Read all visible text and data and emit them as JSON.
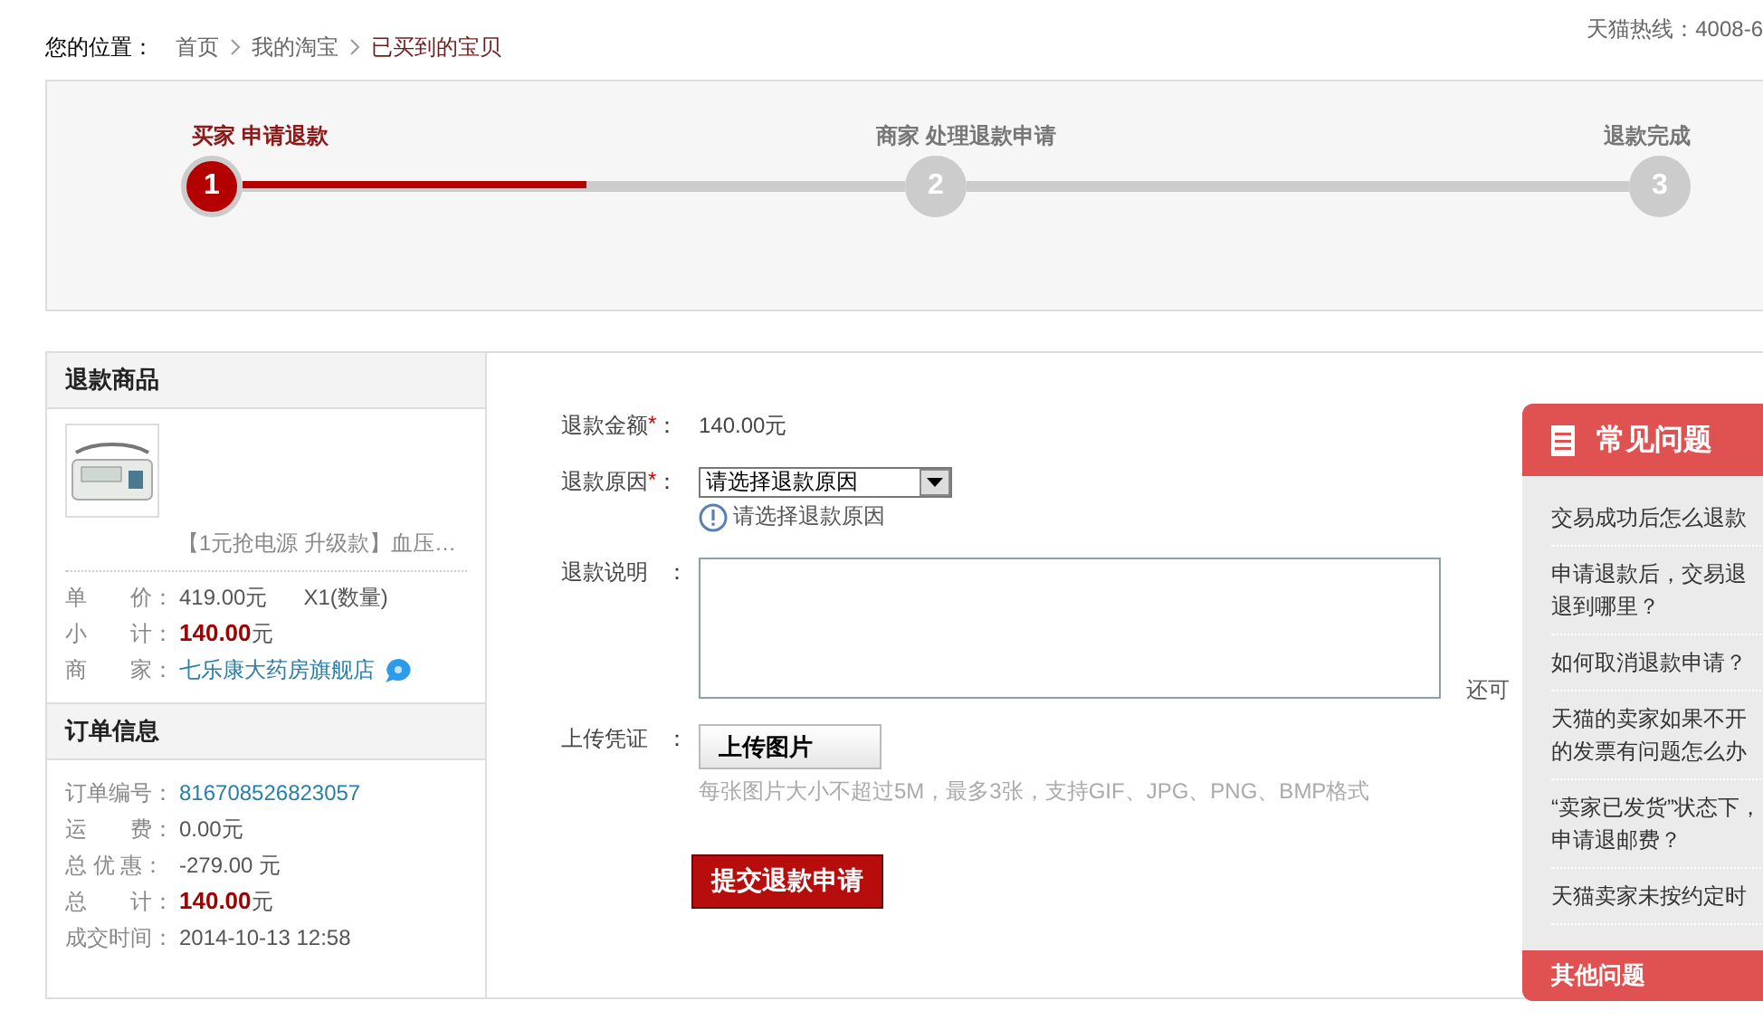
{
  "breadcrumb": {
    "label": "您的位置：",
    "items": [
      {
        "text": "首页",
        "current": false
      },
      {
        "text": "我的淘宝",
        "current": false
      },
      {
        "text": "已买到的宝贝",
        "current": true
      }
    ]
  },
  "hotline": "天猫热线：4008-6",
  "steps": {
    "segments": [
      {
        "level": 0.52
      },
      {
        "level": 0
      }
    ],
    "items": [
      {
        "number": "1",
        "title": "买家 申请退款",
        "selected": true
      },
      {
        "number": "2",
        "title": "商家 处理退款申请",
        "selected": false
      },
      {
        "number": "3",
        "title": "退款完成",
        "selected": false
      }
    ]
  },
  "product_panel": {
    "title": "退款商品",
    "name": "【1元抢电源 升级款】血压…",
    "rows": [
      {
        "label": "单　　价：",
        "value": "419.00元",
        "extra": "X1(数量)",
        "kind": "plain"
      },
      {
        "label": "小　　计：",
        "value": "140.00",
        "unit": "元",
        "kind": "price"
      },
      {
        "label": "商　　家：",
        "value": "七乐康大药房旗舰店",
        "kind": "link"
      }
    ]
  },
  "order_panel": {
    "title": "订单信息",
    "rows": [
      {
        "label": "订单编号：",
        "value": "816708526823057",
        "kind": "link"
      },
      {
        "label": "运　　费：",
        "value": "0.00元",
        "kind": "plain"
      },
      {
        "label": "总 优 惠：",
        "value": "-279.00 元",
        "kind": "plain"
      },
      {
        "label": "总　　计：",
        "value": "140.00",
        "unit": "元",
        "kind": "price"
      },
      {
        "label": "成交时间：",
        "value": "2014-10-13 12:58",
        "kind": "plain"
      }
    ]
  },
  "form": {
    "amount": {
      "label": "退款金额",
      "required_mark": "*",
      "colon": "：",
      "value": "140.00元"
    },
    "reason": {
      "label": "退款原因",
      "required_mark": "*",
      "colon": "：",
      "value": "请选择退款原因",
      "hint": "请选择退款原因"
    },
    "description": {
      "label": "退款说明",
      "colon": "：",
      "counter": "还可"
    },
    "upload": {
      "label": "上传凭证",
      "colon": "：",
      "button": "上传图片",
      "note": "每张图片大小不超过5M，最多3张，支持GIF、JPG、PNG、BMP格式"
    },
    "submit": "提交退款申请"
  },
  "faq": {
    "title": "常见问题",
    "items": [
      {
        "lines": [
          "交易成功后怎么退款"
        ]
      },
      {
        "lines": [
          "申请退款后，交易退",
          "退到哪里？"
        ]
      },
      {
        "lines": [
          "如何取消退款申请？"
        ]
      },
      {
        "lines": [
          "天猫的卖家如果不开",
          "的发票有问题怎么办"
        ]
      },
      {
        "lines": [
          "“卖家已发货”状态下，",
          "申请退邮费？"
        ]
      },
      {
        "lines": [
          "天猫卖家未按约定时"
        ]
      }
    ],
    "footer": "其他问题"
  }
}
